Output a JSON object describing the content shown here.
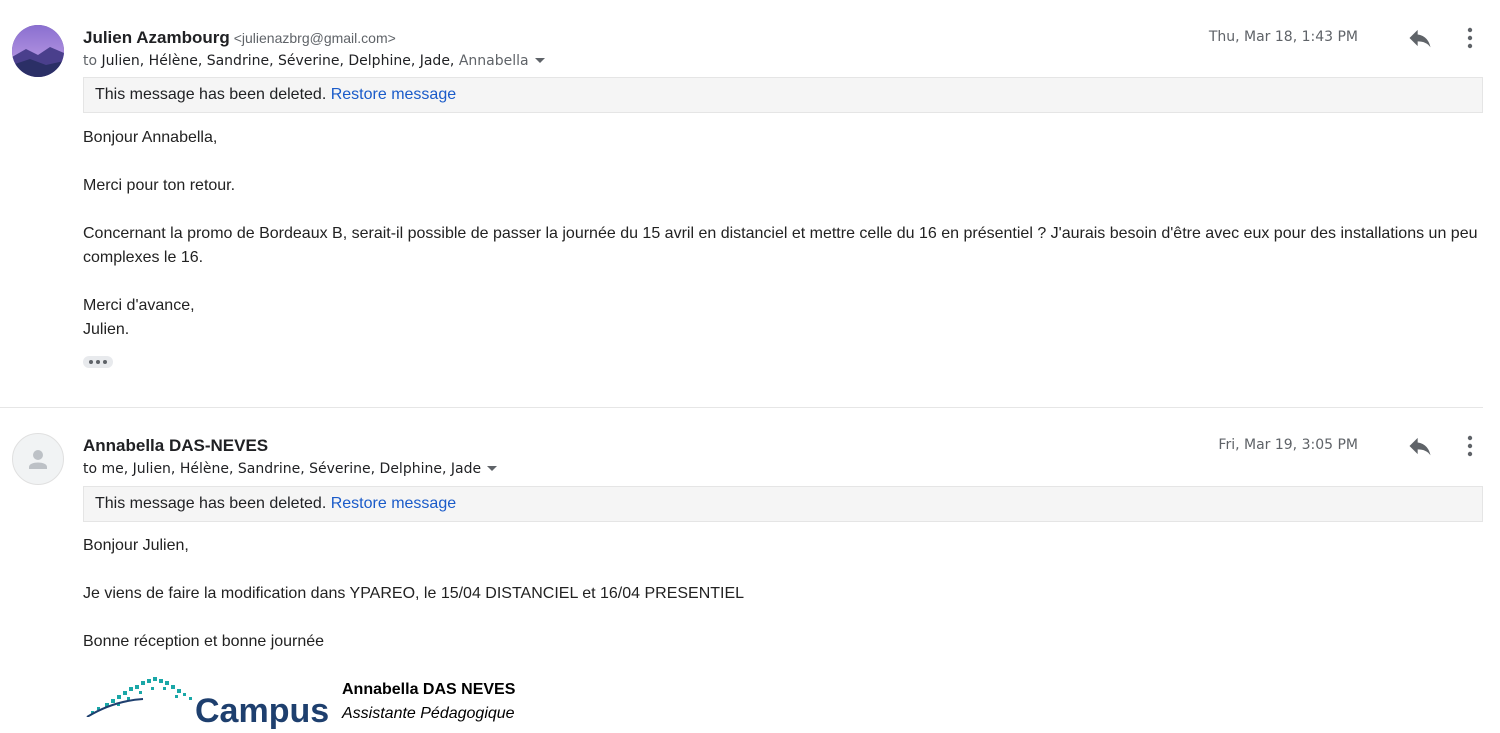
{
  "messages": [
    {
      "sender_name": "Julien Azambourg",
      "sender_email": "<julienazbrg@gmail.com>",
      "to_prefix": "to",
      "recipients": "Julien, Hélène, Sandrine, Séverine, Delphine, Jade,",
      "recipients_extra": "Annabella",
      "date": "Thu, Mar 18, 1:43 PM",
      "deleted_notice": "This message has been deleted.",
      "restore_label": "Restore message",
      "body": [
        "Bonjour Annabella,",
        "Merci pour ton retour.",
        "Concernant la promo de Bordeaux B, serait-il possible de passer la journée du 15 avril en distanciel et mettre celle du 16 en présentiel ? J'aurais besoin d'être avec eux pour des installations un peu complexes le 16.",
        "Merci d'avance,",
        "Julien."
      ]
    },
    {
      "sender_name": "Annabella DAS-NEVES",
      "to_line": "to me, Julien, Hélène, Sandrine, Séverine, Delphine, Jade",
      "date": "Fri, Mar 19, 3:05 PM",
      "deleted_notice": "This message has been deleted.",
      "restore_label": "Restore message",
      "body": [
        "Bonjour Julien,",
        "Je viens de faire la modification dans YPAREO, le 15/04 DISTANCIEL et 16/04 PRESENTIEL",
        "Bonne réception et bonne journée"
      ],
      "signature": {
        "name": "Annabella DAS NEVES",
        "role": "Assistante Pédagogique",
        "logo_text": "Campus"
      }
    }
  ],
  "icons": {
    "reply": "reply-arrow-icon",
    "more": "vertical-dots-icon",
    "expand": "ellipsis-icon"
  },
  "colors": {
    "link": "#1a5bc9",
    "deleted_bg": "#f5f5f5",
    "logo_teal": "#1aa7a7",
    "logo_navy": "#1e3f6e"
  }
}
